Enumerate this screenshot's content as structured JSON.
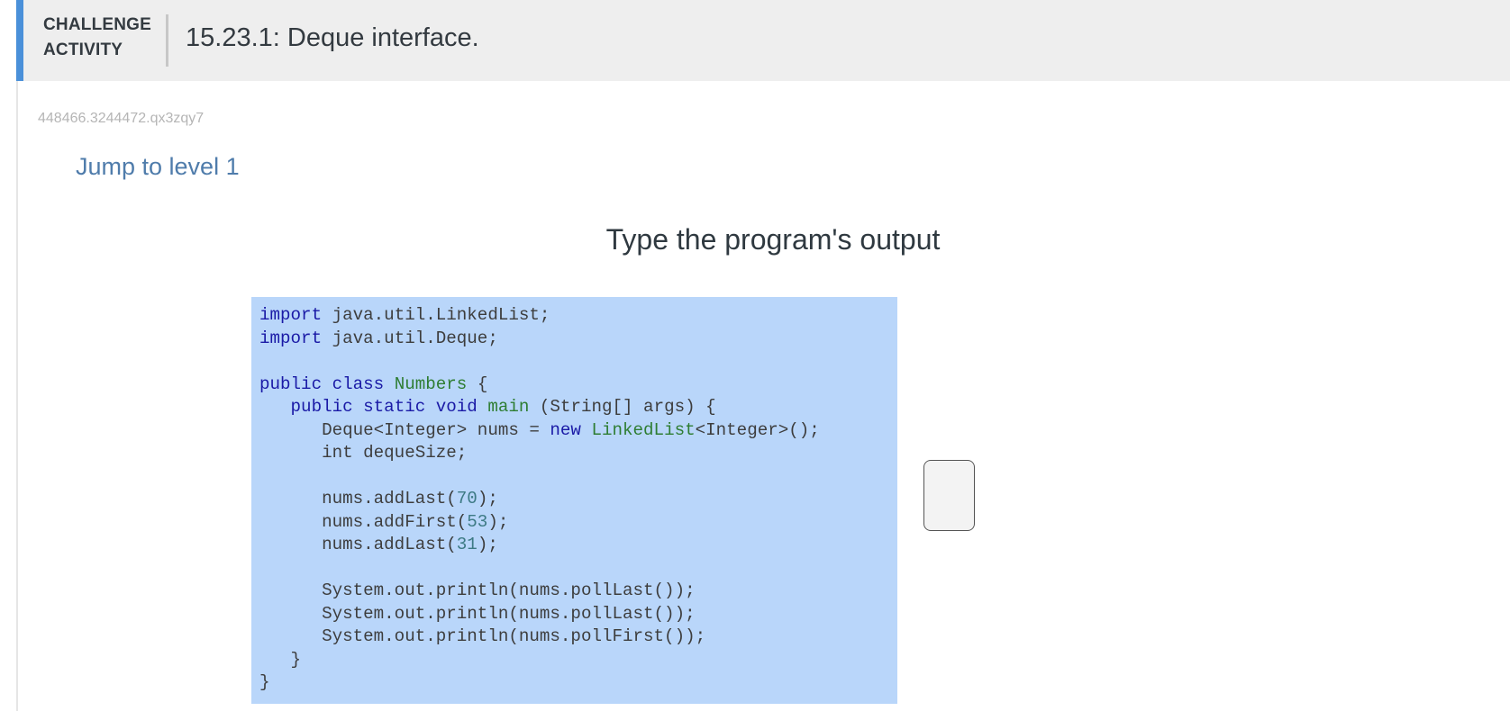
{
  "header": {
    "label_line1": "CHALLENGE",
    "label_line2": "ACTIVITY",
    "title": "15.23.1: Deque interface."
  },
  "activity_id": "448466.3244472.qx3zqy7",
  "jump_link": "Jump to level 1",
  "prompt": "Type the program's output",
  "code": {
    "lines": [
      [
        {
          "t": "kw",
          "s": "import"
        },
        {
          "t": "plain",
          "s": " java.util.LinkedList;"
        }
      ],
      [
        {
          "t": "kw",
          "s": "import"
        },
        {
          "t": "plain",
          "s": " java.util.Deque;"
        }
      ],
      [],
      [
        {
          "t": "kw",
          "s": "public class"
        },
        {
          "t": "plain",
          "s": " "
        },
        {
          "t": "ty",
          "s": "Numbers"
        },
        {
          "t": "plain",
          "s": " {"
        }
      ],
      [
        {
          "t": "plain",
          "s": "   "
        },
        {
          "t": "kw",
          "s": "public static void"
        },
        {
          "t": "plain",
          "s": " "
        },
        {
          "t": "ty",
          "s": "main"
        },
        {
          "t": "plain",
          "s": " (String[] args) {"
        }
      ],
      [
        {
          "t": "plain",
          "s": "      Deque<Integer> nums = "
        },
        {
          "t": "kw",
          "s": "new"
        },
        {
          "t": "plain",
          "s": " "
        },
        {
          "t": "ty",
          "s": "LinkedList"
        },
        {
          "t": "plain",
          "s": "<Integer>();"
        }
      ],
      [
        {
          "t": "plain",
          "s": "      int dequeSize;"
        }
      ],
      [],
      [
        {
          "t": "plain",
          "s": "      nums.addLast("
        },
        {
          "t": "num",
          "s": "70"
        },
        {
          "t": "plain",
          "s": ");"
        }
      ],
      [
        {
          "t": "plain",
          "s": "      nums.addFirst("
        },
        {
          "t": "num",
          "s": "53"
        },
        {
          "t": "plain",
          "s": ");"
        }
      ],
      [
        {
          "t": "plain",
          "s": "      nums.addLast("
        },
        {
          "t": "num",
          "s": "31"
        },
        {
          "t": "plain",
          "s": ");"
        }
      ],
      [],
      [
        {
          "t": "plain",
          "s": "      System.out.println(nums.pollLast());"
        }
      ],
      [
        {
          "t": "plain",
          "s": "      System.out.println(nums.pollLast());"
        }
      ],
      [
        {
          "t": "plain",
          "s": "      System.out.println(nums.pollFirst());"
        }
      ],
      [
        {
          "t": "plain",
          "s": "   }"
        }
      ],
      [
        {
          "t": "plain",
          "s": "}"
        }
      ]
    ]
  },
  "answer": {
    "value": "",
    "placeholder": ""
  },
  "colors": {
    "accent": "#4a90d9",
    "header_bg": "#eeeeee",
    "code_bg": "#b9d6fa",
    "link": "#4f7cab"
  }
}
